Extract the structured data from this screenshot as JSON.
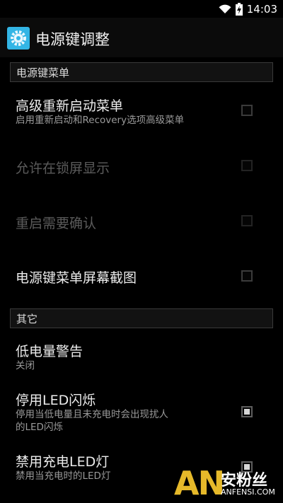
{
  "status_bar": {
    "time": "14:03",
    "icons": [
      "wifi-icon",
      "battery-charging-icon"
    ]
  },
  "action_bar": {
    "title": "电源键调整",
    "icon": "settings-gear-icon",
    "accent_color": "#33b5e5"
  },
  "sections": [
    {
      "header": "电源键菜单",
      "items": [
        {
          "title": "高级重新启动菜单",
          "summary": "启用重新启动和Recovery选项高级菜单",
          "checked": false,
          "enabled": true
        },
        {
          "title": "允许在锁屏显示",
          "summary": "",
          "checked": false,
          "enabled": false
        },
        {
          "title": "重启需要确认",
          "summary": "",
          "checked": false,
          "enabled": false
        },
        {
          "title": "电源键菜单屏幕截图",
          "summary": "",
          "checked": false,
          "enabled": true
        }
      ]
    },
    {
      "header": "其它",
      "items": [
        {
          "title": "低电量警告",
          "summary": "关闭"
        },
        {
          "title": "停用LED闪烁",
          "summary_line1": "停用当低电量且未充电时会出现扰人",
          "summary_line2": "的LED闪烁",
          "checked": true,
          "enabled": true
        },
        {
          "title": "禁用充电LED灯",
          "summary": "禁用当充电时的LED灯",
          "checked": true,
          "enabled": true
        }
      ]
    }
  ],
  "watermark": {
    "letters": "AN",
    "cn": "安粉丝",
    "en": "ANFENSI.COM",
    "color": "#e6b92a"
  }
}
